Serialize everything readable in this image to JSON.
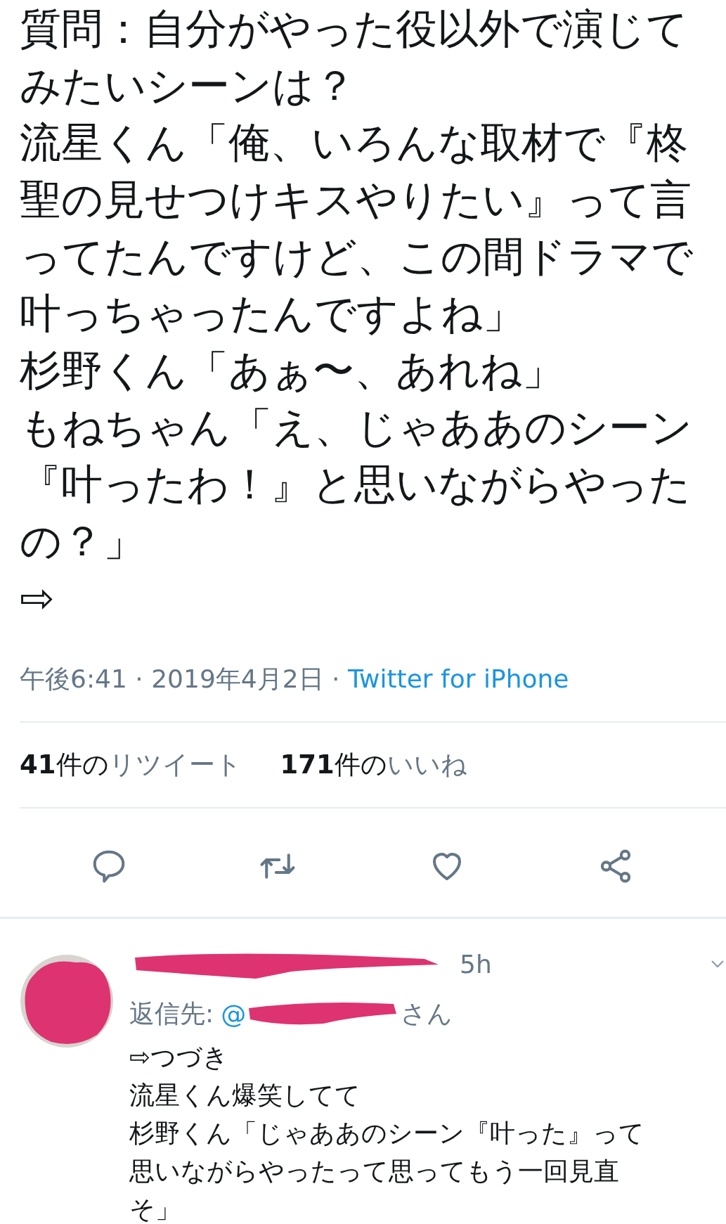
{
  "tweet": {
    "text_lines": [
      "質問：自分がやった役以外で演じて",
      "みたいシーンは？",
      "流星くん「俺、いろんな取材で『柊",
      "聖の見せつけキスやりたい』って言",
      "ってたんですけど、この間ドラマで",
      "叶っちゃったんですよね」",
      "杉野くん「あぁ〜、あれね」",
      "もねちゃん「え、じゃああのシーン",
      "『叶ったわ！』と思いながらやった",
      "の？」",
      "⇨"
    ],
    "timestamp": "午後6:41 · 2019年4月2日 · ",
    "source": "Twitter for iPhone",
    "stats": [
      {
        "count": "41",
        "unit": "件の",
        "label": "リツイート"
      },
      {
        "count": "171",
        "unit": "件の",
        "label": "いいね"
      }
    ],
    "actions": [
      {
        "kind": "reply"
      },
      {
        "kind": "retweet"
      },
      {
        "kind": "like"
      },
      {
        "kind": "share"
      }
    ]
  },
  "reply": {
    "time": "5h",
    "reply_to_label": "返信先:",
    "mention": "@",
    "mention_suffix": "さん",
    "text_lines": [
      "⇨つづき",
      "流星くん爆笑してて",
      "杉野くん「じゃああのシーン『叶った』って",
      "思いながらやったって思ってもう一回見直",
      "そ」"
    ]
  }
}
